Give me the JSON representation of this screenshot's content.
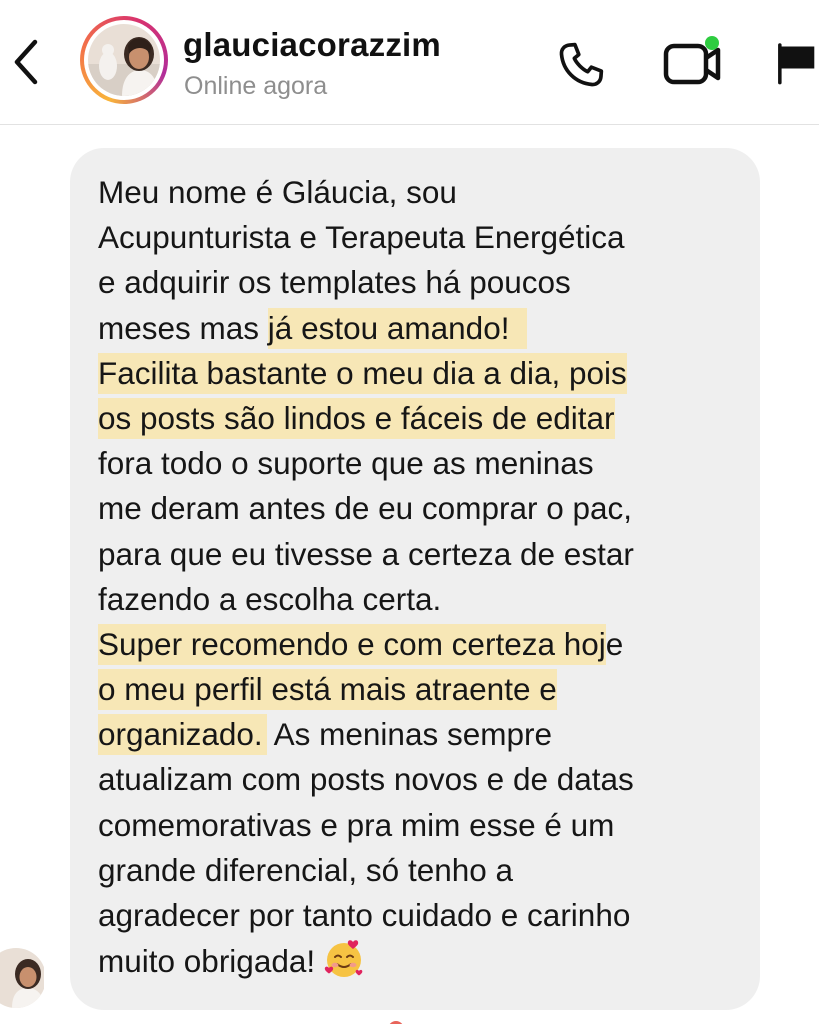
{
  "header": {
    "profile_name": "glauciacorazzim",
    "status": "Online agora",
    "icons": {
      "back": "chevron-left-icon",
      "phone": "phone-icon",
      "video": "video-camera-icon",
      "flag": "flag-icon"
    },
    "online_dot_color": "#2ecc40",
    "story_ring_colors": [
      "#f9b43a",
      "#f2704a",
      "#d8326e",
      "#b12d9a"
    ]
  },
  "message": {
    "lines": [
      [
        {
          "t": "Meu nome é Gláucia, sou",
          "hl": false
        }
      ],
      [
        {
          "t": "Acupunturista e Terapeuta Energética",
          "hl": false
        }
      ],
      [
        {
          "t": "e adquirir os templates há poucos",
          "hl": false
        }
      ],
      [
        {
          "t": "meses mas ",
          "hl": false
        },
        {
          "t": "já estou amando!",
          "hl": true
        }
      ],
      [
        {
          "t": "Facilita bastante o meu dia a dia, pois",
          "hl": true
        }
      ],
      [
        {
          "t": "os posts são lindos e fáceis de editar",
          "hl": true
        }
      ],
      [
        {
          "t": "fora todo o suporte que as meninas",
          "hl": false
        }
      ],
      [
        {
          "t": "me deram antes de eu comprar o pac,",
          "hl": false
        }
      ],
      [
        {
          "t": "para que eu tivesse a certeza de estar",
          "hl": false
        }
      ],
      [
        {
          "t": "fazendo a escolha certa.",
          "hl": false
        }
      ],
      [
        {
          "t": "Super recomendo e com certeza hoj",
          "hl": true
        },
        {
          "t": "e",
          "hl": false
        }
      ],
      [
        {
          "t": "o meu perfil está mais atraente e",
          "hl": true
        }
      ],
      [
        {
          "t": "organizado.",
          "hl": true
        },
        {
          "t": " As meninas sempre",
          "hl": false
        }
      ],
      [
        {
          "t": "atualizam com posts novos e de datas",
          "hl": false
        }
      ],
      [
        {
          "t": "comemorativas e pra mim esse é um",
          "hl": false
        }
      ],
      [
        {
          "t": "grande diferencial, só tenho a",
          "hl": false
        }
      ],
      [
        {
          "t": "agradecer por tanto cuidado e carinho",
          "hl": false
        }
      ],
      [
        {
          "t": "muito obrigada!",
          "hl": false
        }
      ]
    ],
    "emoji": "smiling-face-with-hearts-icon",
    "highlight_color": "#f7e7b6",
    "bubble_color": "#efefef"
  }
}
